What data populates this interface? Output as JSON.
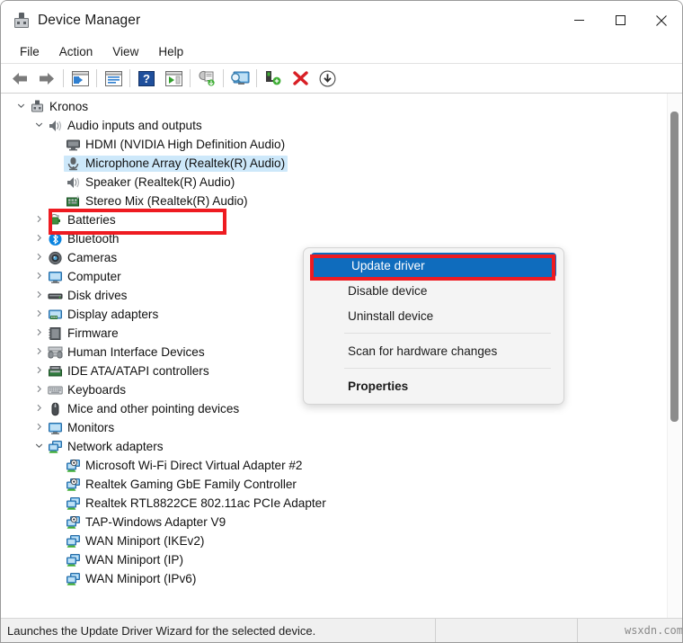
{
  "window": {
    "title": "Device Manager",
    "title_icon": "device-manager-icon",
    "controls": {
      "minimize": "minimize-icon",
      "maximize": "maximize-icon",
      "close": "close-icon"
    }
  },
  "menubar": {
    "items": [
      {
        "label": "File"
      },
      {
        "label": "Action"
      },
      {
        "label": "View"
      },
      {
        "label": "Help"
      }
    ]
  },
  "toolbar": {
    "buttons": [
      {
        "name": "back-arrow-icon"
      },
      {
        "name": "forward-arrow-icon"
      },
      {
        "name": "show-hide-console-tree-icon"
      },
      {
        "name": "properties-icon"
      },
      {
        "name": "help-icon"
      },
      {
        "name": "update-driver-icon"
      },
      {
        "name": "scan-for-hardware-changes-icon"
      },
      {
        "name": "show-devices-by-connection-icon"
      },
      {
        "name": "enable-device-icon"
      },
      {
        "name": "uninstall-device-icon"
      },
      {
        "name": "download-icon"
      }
    ]
  },
  "tree": {
    "nodes": [
      {
        "label": "Kronos",
        "indent": 0,
        "chevron": "expanded",
        "icon": "computer-root-icon"
      },
      {
        "label": "Audio inputs and outputs",
        "indent": 1,
        "chevron": "expanded",
        "icon": "speaker-icon"
      },
      {
        "label": "HDMI (NVIDIA High Definition Audio)",
        "indent": 2,
        "chevron": "none",
        "icon": "audio-output-icon"
      },
      {
        "label": "Microphone Array (Realtek(R) Audio)",
        "indent": 2,
        "chevron": "none",
        "icon": "microphone-icon",
        "selected": true
      },
      {
        "label": "Speaker (Realtek(R) Audio)",
        "indent": 2,
        "chevron": "none",
        "icon": "speaker-icon"
      },
      {
        "label": "Stereo Mix (Realtek(R) Audio)",
        "indent": 2,
        "chevron": "none",
        "icon": "sound-card-icon"
      },
      {
        "label": "Batteries",
        "indent": 1,
        "chevron": "collapsed",
        "icon": "battery-icon"
      },
      {
        "label": "Bluetooth",
        "indent": 1,
        "chevron": "collapsed",
        "icon": "bluetooth-icon"
      },
      {
        "label": "Cameras",
        "indent": 1,
        "chevron": "collapsed",
        "icon": "camera-icon"
      },
      {
        "label": "Computer",
        "indent": 1,
        "chevron": "collapsed",
        "icon": "monitor-icon"
      },
      {
        "label": "Disk drives",
        "indent": 1,
        "chevron": "collapsed",
        "icon": "disk-drive-icon"
      },
      {
        "label": "Display adapters",
        "indent": 1,
        "chevron": "collapsed",
        "icon": "display-adapter-icon"
      },
      {
        "label": "Firmware",
        "indent": 1,
        "chevron": "collapsed",
        "icon": "firmware-chip-icon"
      },
      {
        "label": "Human Interface Devices",
        "indent": 1,
        "chevron": "collapsed",
        "icon": "hid-icon"
      },
      {
        "label": "IDE ATA/ATAPI controllers",
        "indent": 1,
        "chevron": "collapsed",
        "icon": "ide-controller-icon"
      },
      {
        "label": "Keyboards",
        "indent": 1,
        "chevron": "collapsed",
        "icon": "keyboard-icon"
      },
      {
        "label": "Mice and other pointing devices",
        "indent": 1,
        "chevron": "collapsed",
        "icon": "mouse-icon"
      },
      {
        "label": "Monitors",
        "indent": 1,
        "chevron": "collapsed",
        "icon": "monitor-icon"
      },
      {
        "label": "Network adapters",
        "indent": 1,
        "chevron": "expanded",
        "icon": "network-adapter-icon"
      },
      {
        "label": "Microsoft Wi-Fi Direct Virtual Adapter #2",
        "indent": 2,
        "chevron": "none",
        "icon": "virtual-network-adapter-icon"
      },
      {
        "label": "Realtek Gaming GbE Family Controller",
        "indent": 2,
        "chevron": "none",
        "icon": "virtual-network-adapter-icon"
      },
      {
        "label": "Realtek RTL8822CE 802.11ac PCIe Adapter",
        "indent": 2,
        "chevron": "none",
        "icon": "network-adapter-icon"
      },
      {
        "label": "TAP-Windows Adapter V9",
        "indent": 2,
        "chevron": "none",
        "icon": "virtual-network-adapter-icon"
      },
      {
        "label": "WAN Miniport (IKEv2)",
        "indent": 2,
        "chevron": "none",
        "icon": "network-adapter-icon"
      },
      {
        "label": "WAN Miniport (IP)",
        "indent": 2,
        "chevron": "none",
        "icon": "network-adapter-icon"
      },
      {
        "label": "WAN Miniport (IPv6)",
        "indent": 2,
        "chevron": "none",
        "icon": "network-adapter-icon"
      }
    ]
  },
  "context_menu": {
    "items": [
      {
        "label": "Update driver",
        "highlight": true,
        "bold": false
      },
      {
        "label": "Disable device",
        "highlight": false,
        "bold": false
      },
      {
        "label": "Uninstall device",
        "highlight": false,
        "bold": false
      },
      {
        "separator": true
      },
      {
        "label": "Scan for hardware changes",
        "highlight": false,
        "bold": false
      },
      {
        "separator": true
      },
      {
        "label": "Properties",
        "highlight": false,
        "bold": true
      }
    ]
  },
  "annotations": {
    "color": "#ee1b21",
    "boxes": [
      "audio-inputs-and-outputs",
      "update-driver"
    ]
  },
  "statusbar": {
    "text": "Launches the Update Driver Wizard for the selected device.",
    "watermark": "wsxdn.com"
  },
  "colors": {
    "selection_blue": "#0f6cbd",
    "tree_selection": "#cde8fa",
    "annotation_red": "#ee1b21"
  }
}
